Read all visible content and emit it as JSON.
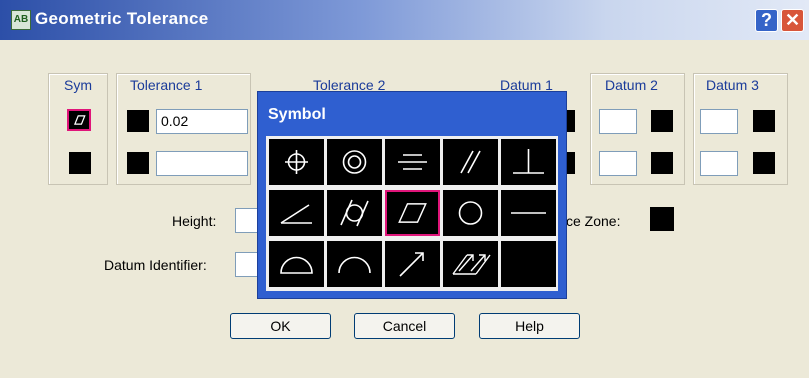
{
  "window": {
    "title": "Geometric Tolerance",
    "app_icon_text": "AB",
    "help_glyph": "?",
    "close_glyph": "✕"
  },
  "columns": {
    "sym": "Sym",
    "tol1": "Tolerance 1",
    "tol2": "Tolerance 2",
    "datum1": "Datum 1",
    "datum2": "Datum 2",
    "datum3": "Datum 3"
  },
  "row1": {
    "tol1_value": "0.02"
  },
  "row2": {
    "tol1_value": ""
  },
  "labels": {
    "height": "Height:",
    "datum_identifier": "Datum Identifier:",
    "projected_zone": "ce Zone:"
  },
  "buttons": {
    "ok": "OK",
    "cancel": "Cancel",
    "help": "Help"
  },
  "popup": {
    "title": "Symbol",
    "symbols": [
      "position",
      "concentricity",
      "symmetry",
      "parallelism",
      "perpendicularity",
      "angularity",
      "cylindricity",
      "flatness",
      "circularity",
      "straightness",
      "profile-of-surface",
      "profile-of-line",
      "circular-runout",
      "total-runout",
      "none"
    ],
    "selected": "flatness"
  },
  "colors": {
    "selection": "#e0157a",
    "popup_frame": "#2f5fd0",
    "column_label": "#1a3b9a"
  }
}
